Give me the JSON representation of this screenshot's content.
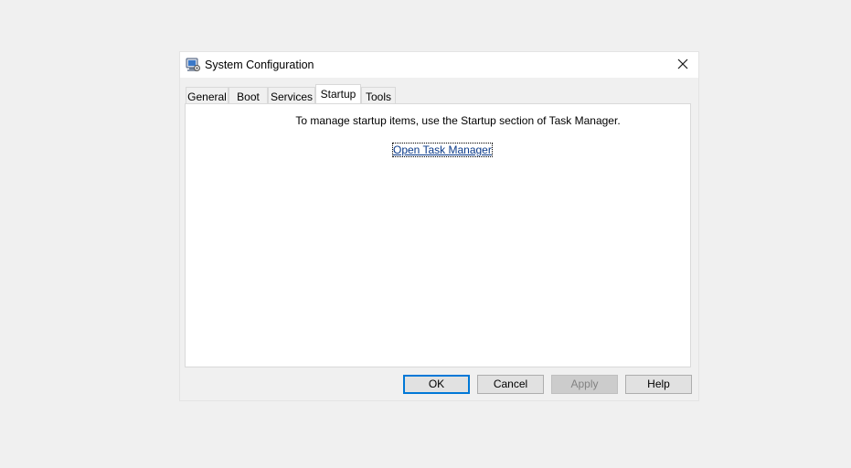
{
  "window": {
    "title": "System Configuration",
    "icon": "msconfig-icon",
    "close_glyph": "✕"
  },
  "tabs": [
    {
      "label": "General",
      "active": false
    },
    {
      "label": "Boot",
      "active": false
    },
    {
      "label": "Services",
      "active": false
    },
    {
      "label": "Startup",
      "active": true
    },
    {
      "label": "Tools",
      "active": false
    }
  ],
  "startup_panel": {
    "message": "To manage startup items, use the Startup section of Task Manager.",
    "link_label": "Open Task Manager"
  },
  "buttons": {
    "ok": "OK",
    "cancel": "Cancel",
    "apply": "Apply",
    "help": "Help"
  },
  "colors": {
    "accent": "#0078d7",
    "link": "#0a3a8a"
  }
}
